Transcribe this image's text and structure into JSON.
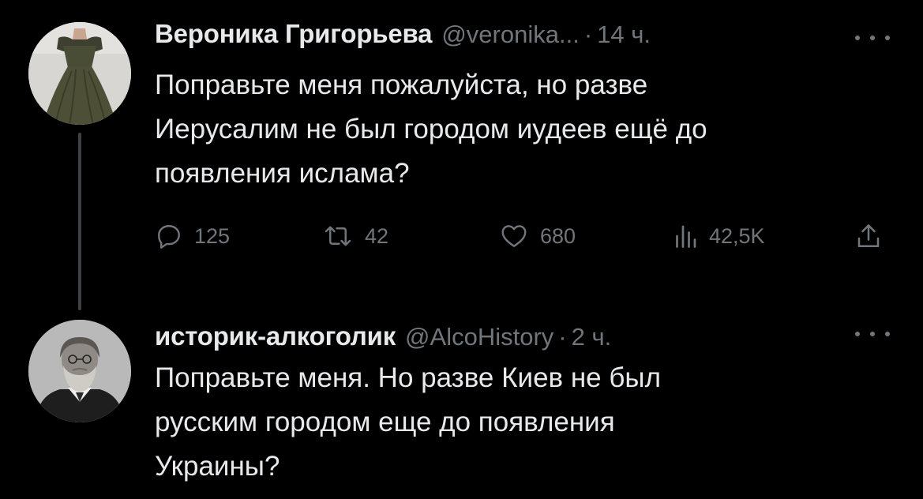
{
  "tweets": [
    {
      "display_name": "Вероника Григорьева",
      "handle": "@veronika...",
      "separator": "·",
      "time": "14 ч.",
      "text_lines": [
        "Поправьте меня пожалуйста, но разве",
        "Иерусалим не был городом иудеев ещё до",
        "появления ислама?"
      ],
      "actions": {
        "replies": "125",
        "retweets": "42",
        "likes": "680",
        "views": "42,5K"
      },
      "avatar_icon": "woman-in-green-dress-avatar",
      "menu_icon": "more-dots-icon"
    },
    {
      "display_name": "историк-алкоголик",
      "handle": "@AlcoHistory",
      "separator": "·",
      "time": "2 ч.",
      "text_lines": [
        "Поправьте меня. Но разве Киев не был",
        "русским городом еще до появления",
        "Украины?"
      ],
      "avatar_icon": "bearded-man-portrait-avatar",
      "menu_icon": "more-dots-icon"
    }
  ],
  "colors": {
    "background": "#000000",
    "text_primary": "#e7e9ea",
    "text_secondary": "#71767b",
    "thread_line": "#3e4144"
  }
}
